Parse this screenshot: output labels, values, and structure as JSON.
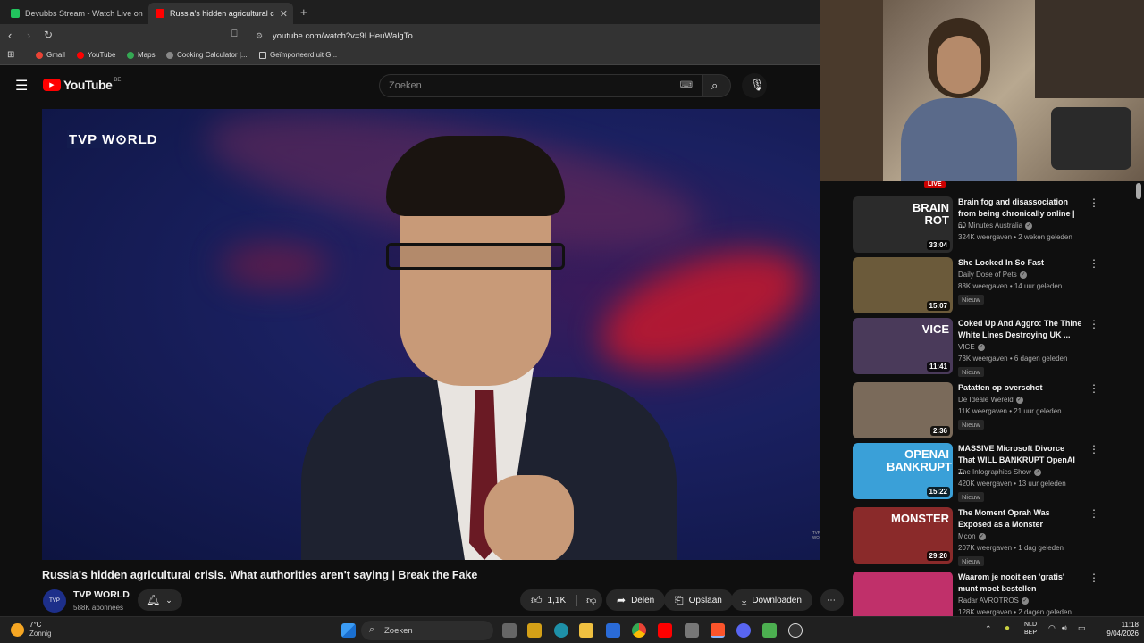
{
  "browser": {
    "tabs": [
      {
        "label": "Devubbs Stream - Watch Live on",
        "active": false,
        "favicon_color": "#22c55e"
      },
      {
        "label": "Russia's hidden agricultural c",
        "active": true,
        "favicon_color": "#ff0000"
      }
    ],
    "url": "youtube.com/watch?v=9LHeuWalgTo",
    "bookmarks": [
      "Gmail",
      "YouTube",
      "Maps",
      "Cooking Calculator |...",
      "Geïmporteerd uit G..."
    ]
  },
  "youtube": {
    "logo": "YouTube",
    "logo_region": "BE",
    "search_placeholder": "Zoeken"
  },
  "player": {
    "overlay_logo": "TVP W⊙RLD",
    "corner_tag": "TVP WORLD"
  },
  "video": {
    "title": "Russia's hidden agricultural crisis. What authorities aren't saying | Break the Fake",
    "channel": "TVP WORLD",
    "subscribers": "588K abonnees",
    "likes": "1,1K",
    "share_label": "Delen",
    "save_label": "Opslaan",
    "download_label": "Downloaden"
  },
  "sidebar": {
    "live_label": "LIVE",
    "items": [
      {
        "title": "Brain fog and disassociation from being chronically online | ...",
        "channel": "60 Minutes Australia",
        "meta": "324K weergaven • 2 weken geleden",
        "duration": "33:04",
        "new": "",
        "thumb_text": "BRAIN ROT",
        "thumb_bg": "#2b2b2b"
      },
      {
        "title": "She Locked In So Fast",
        "channel": "Daily Dose of Pets",
        "meta": "88K weergaven • 14 uur geleden",
        "duration": "15:07",
        "new": "Nieuw",
        "thumb_text": "",
        "thumb_bg": "#6b5a3a"
      },
      {
        "title": "Coked Up And Aggro: The Thine White Lines Destroying UK ...",
        "channel": "VICE",
        "meta": "73K weergaven • 6 dagen geleden",
        "duration": "11:41",
        "new": "Nieuw",
        "thumb_text": "VICE",
        "thumb_bg": "#4a3a5a"
      },
      {
        "title": "Patatten op overschot",
        "channel": "De Ideale Wereld",
        "meta": "11K weergaven • 21 uur geleden",
        "duration": "2:36",
        "new": "Nieuw",
        "thumb_text": "",
        "thumb_bg": "#7a6a5a"
      },
      {
        "title": "MASSIVE Microsoft Divorce That WILL BANKRUPT OpenAI ...",
        "channel": "The Infographics Show",
        "meta": "420K weergaven • 13 uur geleden",
        "duration": "15:22",
        "new": "Nieuw",
        "thumb_text": "OPENAI BANKRUPT",
        "thumb_bg": "#3aa0d8"
      },
      {
        "title": "The Moment Oprah Was Exposed as a Monster",
        "channel": "Mcon",
        "meta": "207K weergaven • 1 dag geleden",
        "duration": "29:20",
        "new": "Nieuw",
        "thumb_text": "MONSTER",
        "thumb_bg": "#8a2a2a"
      },
      {
        "title": "Waarom je nooit een 'gratis' munt moet bestellen",
        "channel": "Radar AVROTROS",
        "meta": "128K weergaven • 2 dagen geleden",
        "duration": "",
        "new": "",
        "thumb_text": "",
        "thumb_bg": "#c0306a"
      }
    ]
  },
  "taskbar": {
    "weather_temp": "7°C",
    "weather_desc": "Zonnig",
    "search_label": "Zoeken",
    "lang": "NLD",
    "lang_sub": "BEP",
    "time": "11:18",
    "date": "9/04/2026"
  },
  "colors": {
    "youtube_red": "#ff0000",
    "background": "#0f0f0f",
    "pill": "#272727"
  }
}
